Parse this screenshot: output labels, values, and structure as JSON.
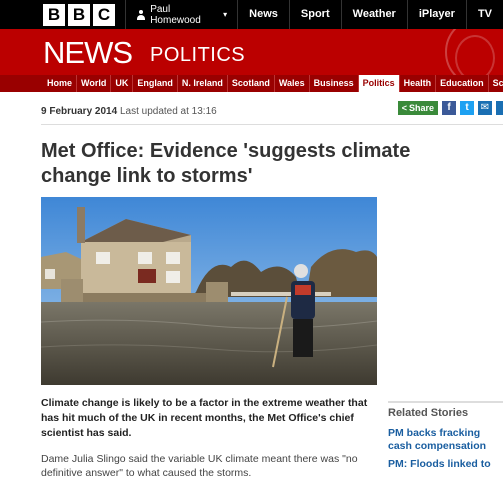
{
  "topbar": {
    "logo_letters": [
      "B",
      "B",
      "C"
    ],
    "account_name": "Paul Homewood",
    "nav": [
      "News",
      "Sport",
      "Weather",
      "iPlayer",
      "TV"
    ]
  },
  "header": {
    "brand": "NEWS",
    "section": "POLITICS"
  },
  "section_nav": [
    {
      "label": "Home",
      "active": false
    },
    {
      "label": "World",
      "active": false
    },
    {
      "label": "UK",
      "active": false
    },
    {
      "label": "England",
      "active": false
    },
    {
      "label": "N. Ireland",
      "active": false
    },
    {
      "label": "Scotland",
      "active": false
    },
    {
      "label": "Wales",
      "active": false
    },
    {
      "label": "Business",
      "active": false
    },
    {
      "label": "Politics",
      "active": true
    },
    {
      "label": "Health",
      "active": false
    },
    {
      "label": "Education",
      "active": false
    },
    {
      "label": "Sci",
      "active": false
    }
  ],
  "article": {
    "date": "9 February 2014",
    "updated": "Last updated at 13:16",
    "share_label": "Share",
    "headline": "Met Office: Evidence 'suggests climate change link to storms'",
    "lead": "Climate change is likely to be a factor in the extreme weather that has hit much of the UK in recent months, the Met Office's chief scientist has said.",
    "para1": "Dame Julia Slingo said the variable UK climate meant there was \"no definitive answer\" to what caused the storms."
  },
  "related": {
    "heading": "Related Stories",
    "links": [
      "PM backs fracking cash compensation",
      "PM: Floods linked to"
    ]
  },
  "colors": {
    "bbc_red": "#bb0000",
    "nav_red": "#990000",
    "link_blue": "#1a5ea0",
    "share_green": "#3a8a3a"
  }
}
